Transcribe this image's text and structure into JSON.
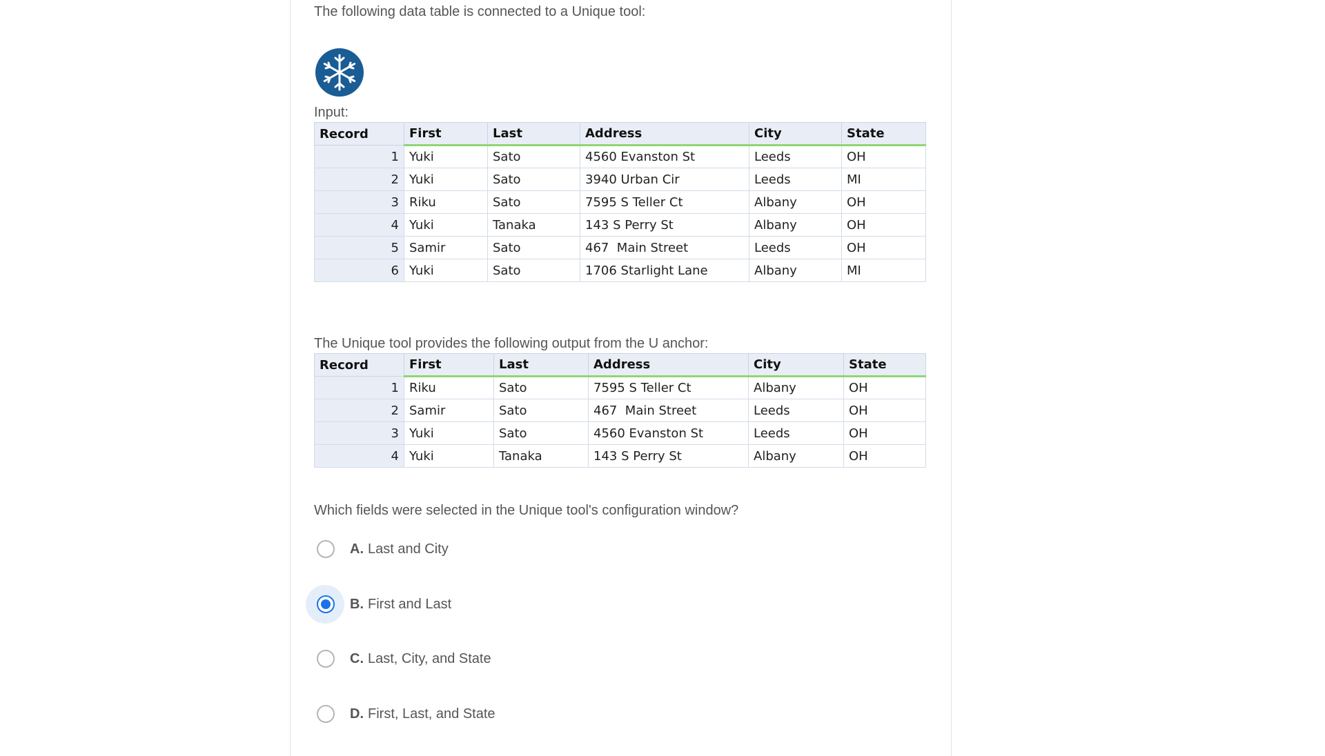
{
  "question": {
    "intro": "The following data table is connected to a Unique tool:",
    "input_label": "Input:",
    "output_label": "The Unique tool provides the following output from the U anchor:",
    "prompt": "Which fields were selected in the Unique tool's configuration window?"
  },
  "tool_icon": "snowflake-icon",
  "input_table": {
    "headers": [
      "Record",
      "First",
      "Last",
      "Address",
      "City",
      "State"
    ],
    "rows": [
      [
        "1",
        "Yuki",
        "Sato",
        "4560 Evanston St",
        "Leeds",
        "OH"
      ],
      [
        "2",
        "Yuki",
        "Sato",
        "3940 Urban Cir",
        "Leeds",
        "MI"
      ],
      [
        "3",
        "Riku",
        "Sato",
        "7595 S Teller Ct",
        "Albany",
        "OH"
      ],
      [
        "4",
        "Yuki",
        "Tanaka",
        "143 S Perry St",
        "Albany",
        "OH"
      ],
      [
        "5",
        "Samir",
        "Sato",
        "467  Main Street",
        "Leeds",
        "OH"
      ],
      [
        "6",
        "Yuki",
        "Sato",
        "1706 Starlight Lane",
        "Albany",
        "MI"
      ]
    ]
  },
  "output_table": {
    "headers": [
      "Record",
      "First",
      "Last",
      "Address",
      "City",
      "State"
    ],
    "rows": [
      [
        "1",
        "Riku",
        "Sato",
        "7595 S Teller Ct",
        "Albany",
        "OH"
      ],
      [
        "2",
        "Samir",
        "Sato",
        "467  Main Street",
        "Leeds",
        "OH"
      ],
      [
        "3",
        "Yuki",
        "Sato",
        "4560 Evanston St",
        "Leeds",
        "OH"
      ],
      [
        "4",
        "Yuki",
        "Tanaka",
        "143 S Perry St",
        "Albany",
        "OH"
      ]
    ]
  },
  "options": [
    {
      "letter": "A.",
      "text": "Last and City",
      "selected": false
    },
    {
      "letter": "B.",
      "text": "First and Last",
      "selected": true
    },
    {
      "letter": "C.",
      "text": "Last, City, and State",
      "selected": false
    },
    {
      "letter": "D.",
      "text": "First, Last, and State",
      "selected": false
    }
  ],
  "colors": {
    "accent": "#1a73e8",
    "icon_bg": "#1a5c94",
    "header_underline": "#8ed672"
  }
}
